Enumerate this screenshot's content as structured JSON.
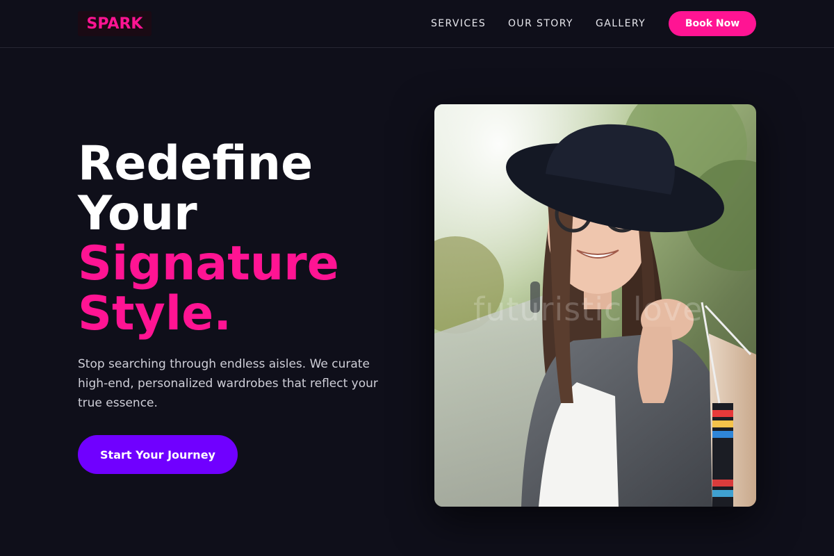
{
  "brand": {
    "logo_text": "SPARK"
  },
  "nav": {
    "items": [
      {
        "label": "SERVICES"
      },
      {
        "label": "OUR STORY"
      },
      {
        "label": "GALLERY"
      }
    ],
    "cta_label": "Book Now"
  },
  "hero": {
    "title_line1": "Redefine",
    "title_line2": "Your",
    "title_line3": "Signature",
    "title_line4": "Style.",
    "description": "Stop searching through endless aisles. We curate high-end, personalized wardrobes that reflect your true essence.",
    "cta_label": "Start Your Journey"
  },
  "photo": {
    "watermark": "futuristic love"
  },
  "colors": {
    "background": "#0f0f1a",
    "accent_pink": "#ff1493",
    "accent_purple": "#7000ff"
  }
}
